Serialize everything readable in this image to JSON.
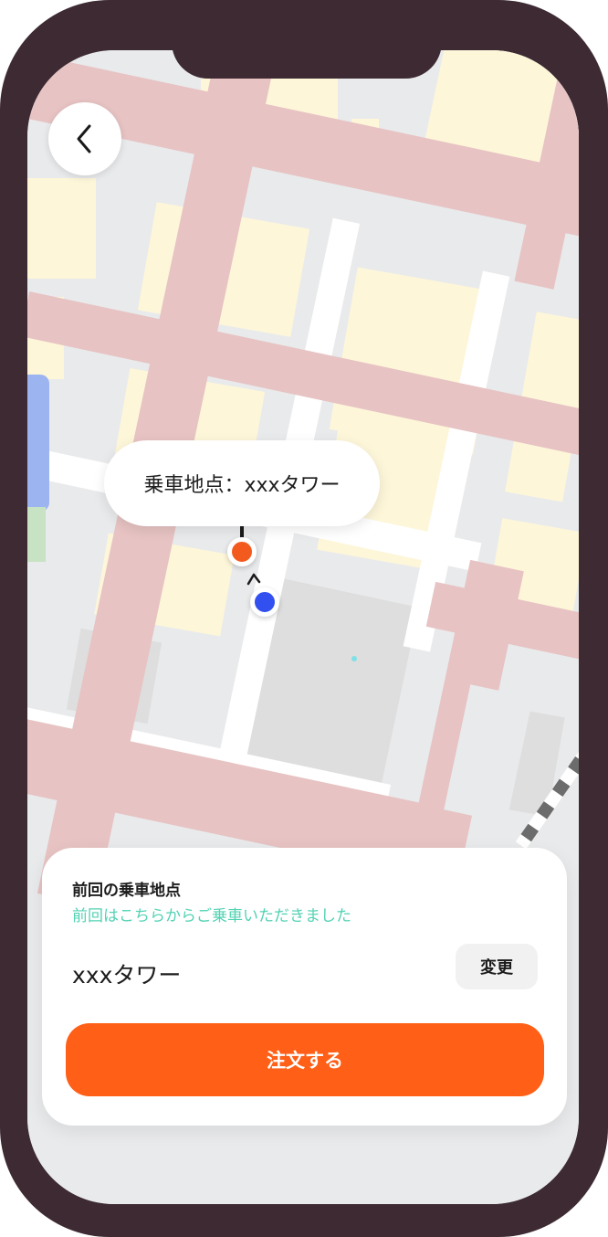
{
  "map": {
    "pickup_label": "乗車地点：xxxタワー"
  },
  "navigation": {
    "back_icon": "chevron-left-icon"
  },
  "card": {
    "title": "前回の乗車地点",
    "subtitle": "前回はこちらからご乗車いただきました",
    "place_name": "xxxタワー",
    "change_label": "変更",
    "order_label": "注文する"
  },
  "colors": {
    "accent": "#ff5f16",
    "pin": "#f35b1e",
    "current_location": "#3250f0",
    "subtitle": "#53d2b4",
    "frame": "#3d2a33"
  }
}
